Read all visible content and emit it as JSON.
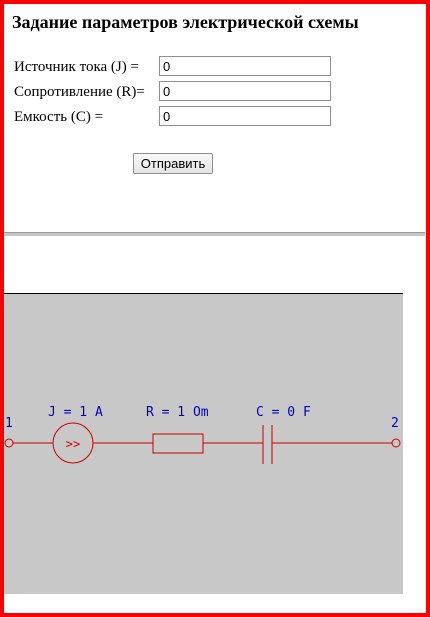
{
  "form": {
    "title": "Задание параметров электрической схемы",
    "fields": [
      {
        "label": "Источник тока (J) =",
        "value": "0"
      },
      {
        "label": "Сопротивление (R)=",
        "value": "0"
      },
      {
        "label": "Емкость (C) =",
        "value": "0"
      }
    ],
    "submit_label": "Отправить"
  },
  "circuit": {
    "node_left": "1",
    "node_right": "2",
    "source_label": "J = 1 A",
    "source_symbol": ">>",
    "resistor_label": "R = 1 Om",
    "capacitor_label": "C = 0 F",
    "colors": {
      "wire": "#cc0000",
      "text": "#0000cc",
      "background": "#c8c8c8",
      "frame": "#ff0000"
    }
  }
}
